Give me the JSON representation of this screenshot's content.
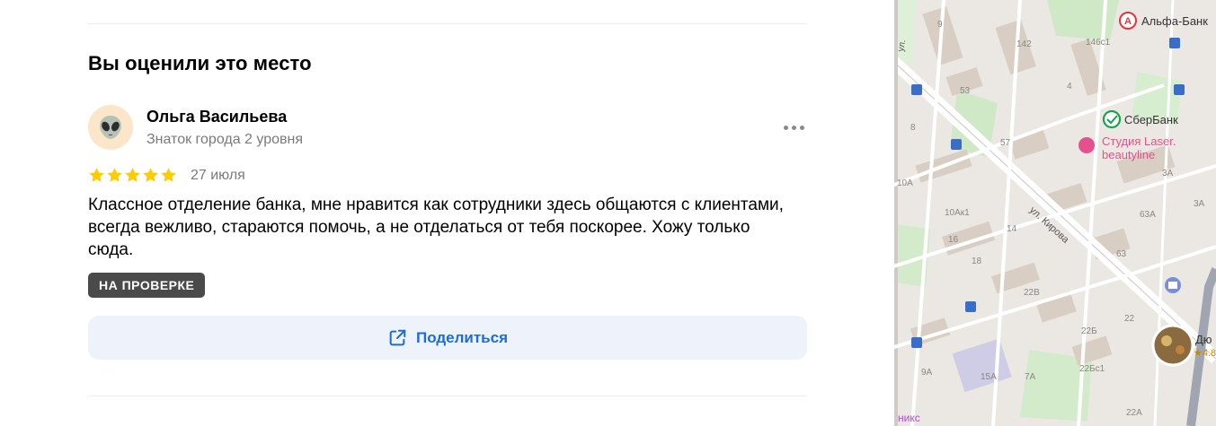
{
  "section": {
    "title": "Вы оценили это место"
  },
  "review": {
    "author_name": "Ольга Васильева",
    "author_status": "Знаток города 2 уровня",
    "rating": 5,
    "date": "27 июля",
    "text": "Классное отделение банка, мне нравится как сотрудники здесь общаются с клиентами, всегда вежливо, стараются помочь, а не отделаться от тебя поскорее. Хожу только сюда.",
    "moderation_badge": "НА ПРОВЕРКЕ"
  },
  "actions": {
    "share_label": "Поделиться"
  },
  "map": {
    "poi": {
      "alfa": "Альфа-Банк",
      "sber": "СберБанк",
      "studio_line1": "Студия Laser.",
      "studio_line2": "beautyline",
      "partial_name": "Дю",
      "partial_rating": "★4.8",
      "bottom_partial": "никс"
    },
    "streets": {
      "kirova": "ул. Кирова",
      "left": "ул."
    },
    "house_numbers": {
      "n142": "142",
      "n146c1": "146с1",
      "n9": "9",
      "n4": "4",
      "n53": "53",
      "n57": "57",
      "n8": "8",
      "n3a": "3А",
      "n10a": "10А",
      "n10ak1": "10Ак1",
      "n63a": "63А",
      "n14": "14",
      "n16": "16",
      "n18": "18",
      "n63": "63",
      "n22v": "22В",
      "n22": "22",
      "n22b": "22Б",
      "n9a": "9А",
      "n15a": "15А",
      "n7a": "7А",
      "n22bc1": "22Бс1",
      "n22a": "22А",
      "n3a_r": "3А"
    },
    "colors": {
      "sber_green": "#1aa24b",
      "alfa_red": "#e8333a",
      "studio_pink": "#e6508c"
    }
  },
  "icons": {
    "avatar": "alien-face-icon",
    "more": "more-dots-icon",
    "star": "star-icon",
    "share": "share-external-icon"
  }
}
